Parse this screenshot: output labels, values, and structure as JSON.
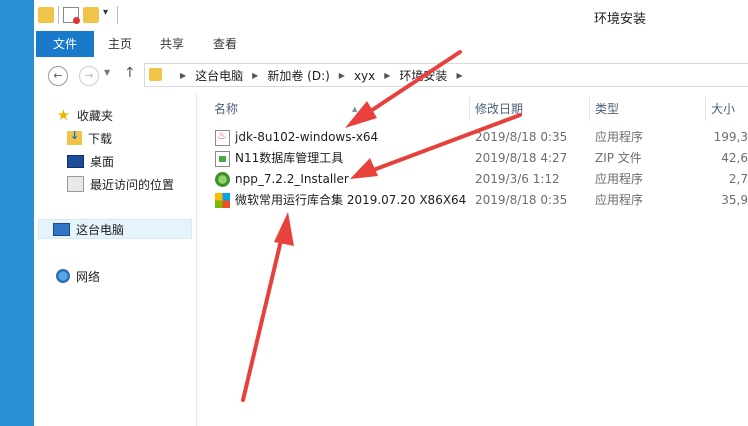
{
  "window": {
    "title": "环境安装"
  },
  "ribbon": {
    "tabs": [
      "文件",
      "主页",
      "共享",
      "查看"
    ]
  },
  "address": {
    "crumbs": [
      "这台电脑",
      "新加卷 (D:)",
      "xyx",
      "环境安装"
    ]
  },
  "sidebar": {
    "favorites": "收藏夹",
    "downloads": "下载",
    "desktop": "桌面",
    "recent": "最近访问的位置",
    "this_pc": "这台电脑",
    "network": "网络"
  },
  "columns": {
    "name": "名称",
    "date": "修改日期",
    "type": "类型",
    "size": "大小"
  },
  "files": [
    {
      "name": "jdk-8u102-windows-x64",
      "date": "2019/8/18 0:35",
      "type": "应用程序",
      "size": "199,3",
      "icon": "java-icon"
    },
    {
      "name": "N11数据库管理工具",
      "date": "2019/8/18 4:27",
      "type": "ZIP 文件",
      "size": "42,6",
      "icon": "zip-icon"
    },
    {
      "name": "npp_7.2.2_Installer",
      "date": "2019/3/6 1:12",
      "type": "应用程序",
      "size": "2,7",
      "icon": "notepad-plus-plus-icon"
    },
    {
      "name": "微软常用运行库合集 2019.07.20 X86X64",
      "date": "2019/8/18 0:35",
      "type": "应用程序",
      "size": "35,9",
      "icon": "windows-installer-icon"
    }
  ],
  "colors": {
    "accent": "#1979ca",
    "window_border": "#2a8fd6",
    "annotation_arrow": "#e8413c"
  }
}
